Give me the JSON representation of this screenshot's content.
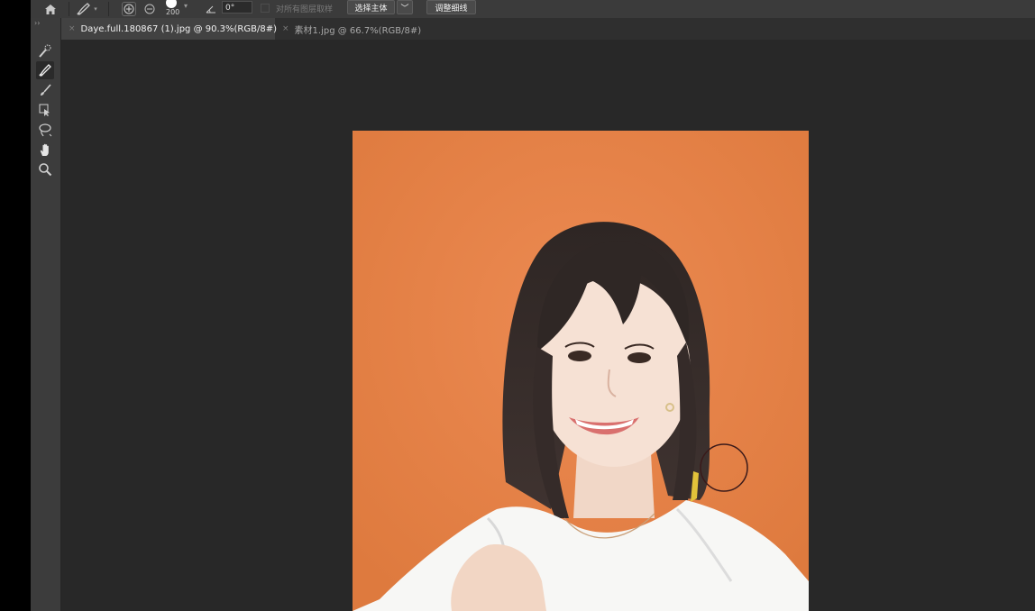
{
  "options_bar": {
    "brush_size": "200",
    "angle_value": "0°",
    "sample_all_layers_label": "对所有图层取样",
    "select_subject_label": "选择主体",
    "refine_hair_label": "调整细线"
  },
  "tabs": [
    {
      "label": "Daye.full.180867 (1).jpg @ 90.3%(RGB/8#)",
      "close": "×",
      "active": true
    },
    {
      "label": "素材1.jpg @ 66.7%(RGB/8#)",
      "close": "×",
      "active": false
    }
  ],
  "toolbar": {
    "collapse": "››",
    "tools": [
      "quick-selection-tool",
      "refine-edge-brush-tool",
      "brush-tool",
      "object-selection-tool",
      "lasso-tool",
      "hand-tool",
      "zoom-tool"
    ],
    "active_tool": "refine-edge-brush-tool"
  },
  "colors": {
    "canvas_background": "#e7834a",
    "workspace": "#282828",
    "panel": "#3c3c3c"
  }
}
